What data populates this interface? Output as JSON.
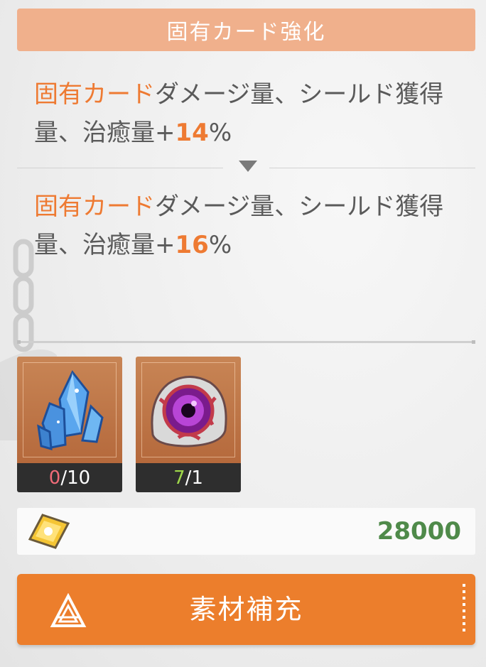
{
  "header": {
    "title": "固有カード強化"
  },
  "effect_before": {
    "highlight": "固有カード",
    "text": "ダメージ量、シールド獲得量、治癒量+",
    "value": "14",
    "unit": "%"
  },
  "effect_after": {
    "highlight": "固有カード",
    "text": "ダメージ量、シールド獲得量、治癒量+",
    "value": "16",
    "unit": "%"
  },
  "materials": [
    {
      "icon": "blue-crystal-icon",
      "have": "0",
      "need": "/10",
      "have_color": "#ef6b78"
    },
    {
      "icon": "purple-eye-orb-icon",
      "have": "7",
      "need": "/1",
      "have_color": "#9fd84a"
    }
  ],
  "cost": {
    "icon": "gold-gem-icon",
    "amount": "28000"
  },
  "action": {
    "label": "素材補充",
    "icon": "triangle-logo-icon"
  }
}
